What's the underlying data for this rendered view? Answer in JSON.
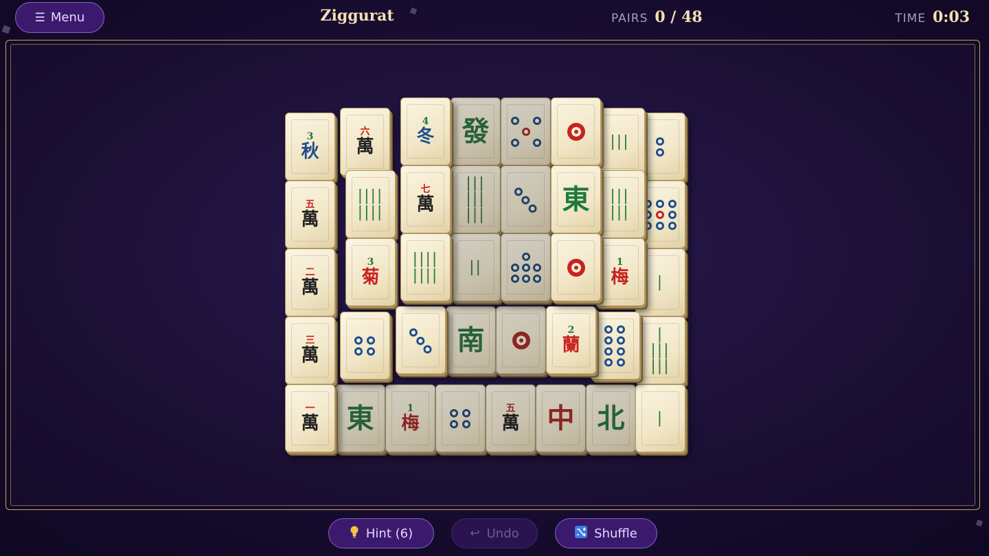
{
  "header": {
    "menu_label": "Menu",
    "menu_icon": "☰",
    "title": "Ziggurat",
    "pairs_label": "PAIRS",
    "pairs_value": "0 / 48",
    "time_label": "TIME",
    "time_value": "0:03"
  },
  "controls": {
    "hint_label": "Hint (6)",
    "hint_icon": "lightbulb",
    "undo_label": "Undo",
    "undo_icon": "↩",
    "shuffle_label": "Shuffle",
    "shuffle_icon": "shuffle"
  },
  "tiles": {
    "r1c1": {
      "num": "3",
      "char": "秋"
    },
    "r1c2": {
      "num": "六",
      "char": "萬"
    },
    "r1c3": {
      "num": "4",
      "char": "冬"
    },
    "r1c4": {
      "big": "發"
    },
    "r1c5": {
      "glyph": "5-dots"
    },
    "r1c6": {
      "glyph": "1-dot"
    },
    "r1c7": {
      "glyph": "|||"
    },
    "r1c8": {
      "glyph": "2-dots"
    },
    "r2c1": {
      "num": "五",
      "char": "萬"
    },
    "r2c2": {
      "glyph": "||||\n||||"
    },
    "r2c3": {
      "num": "七",
      "char": "萬"
    },
    "r2c4": {
      "glyph": "|||\n|||\n|||"
    },
    "r2c5": {
      "glyph": "3-dots"
    },
    "r2c6": {
      "big": "東"
    },
    "r2c7": {
      "glyph": "|||\n|||"
    },
    "r2c8": {
      "glyph": "9-dots"
    },
    "r3c1": {
      "num": "二",
      "char": "萬"
    },
    "r3c2": {
      "num": "3",
      "char": "菊"
    },
    "r3c3": {
      "glyph": "||||\n||||"
    },
    "r3c4": {
      "glyph": "||"
    },
    "r3c5": {
      "glyph": "7-dots"
    },
    "r3c6": {
      "glyph": "1-dot"
    },
    "r3c7": {
      "num": "1",
      "char": "梅"
    },
    "r3c8": {
      "glyph": "|"
    },
    "r4c1": {
      "num": "三",
      "char": "萬"
    },
    "r4c2": {
      "glyph": "4-dots"
    },
    "r4c3": {
      "glyph": "3-dots"
    },
    "r4c4": {
      "big": "南"
    },
    "r4c5": {
      "glyph": "1-dot"
    },
    "r4c6": {
      "num": "2",
      "char": "蘭"
    },
    "r4c7": {
      "glyph": "8-dots"
    },
    "r4c8": {
      "glyph": "|\n|||\n|||"
    },
    "r5c1": {
      "num": "一",
      "char": "萬"
    },
    "r5c2": {
      "big": "東"
    },
    "r5c3": {
      "num": "1",
      "char": "梅"
    },
    "r5c4": {
      "glyph": "4-dots"
    },
    "r5c5": {
      "num": "五",
      "char": "萬"
    },
    "r5c6": {
      "big": "中"
    },
    "r5c7": {
      "big": "北"
    },
    "r5c8": {
      "glyph": "|"
    }
  }
}
